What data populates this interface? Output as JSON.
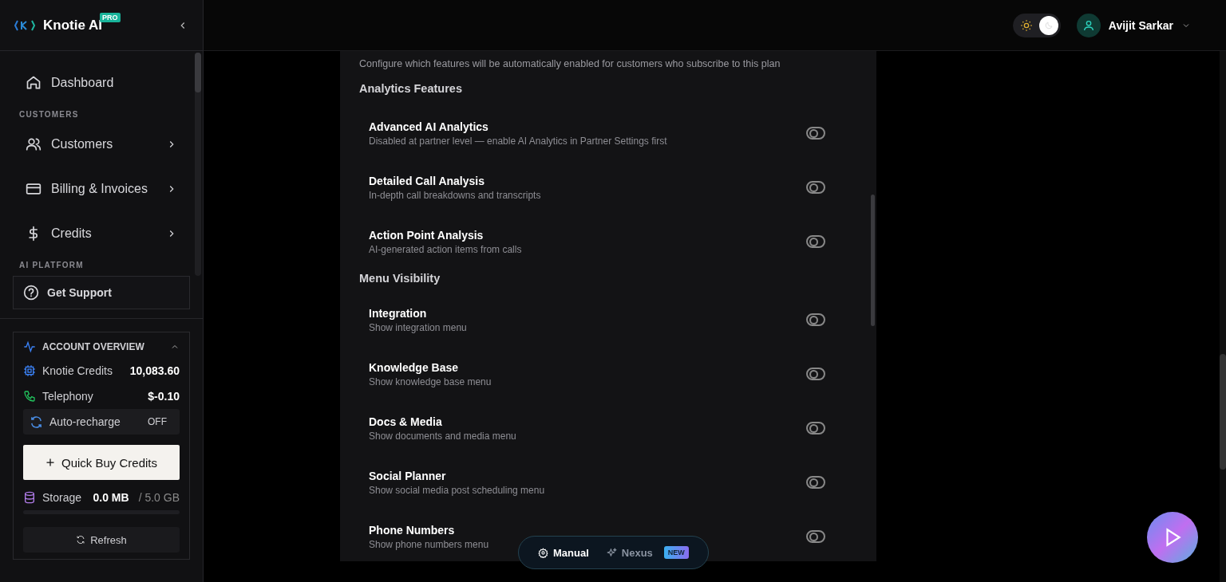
{
  "sidebar": {
    "brand": "Knotie AI",
    "badge": "PRO",
    "nav": [
      {
        "kind": "item",
        "label": "Dashboard",
        "chevron": false
      },
      {
        "kind": "section",
        "label": "CUSTOMERS"
      },
      {
        "kind": "item",
        "label": "Customers",
        "chevron": true
      },
      {
        "kind": "item",
        "label": "Billing & Invoices",
        "chevron": true
      },
      {
        "kind": "item",
        "label": "Credits",
        "chevron": true
      },
      {
        "kind": "section",
        "label": "AI PLATFORM"
      },
      {
        "kind": "boxed",
        "label": "Get Support"
      }
    ],
    "overview": {
      "title": "ACCOUNT OVERVIEW",
      "expanded": true,
      "credits": {
        "label": "Knotie Credits",
        "value": "10,083.60"
      },
      "telephony": {
        "label": "Telephony",
        "value": "$-0.10"
      },
      "auto_recharge": {
        "label": "Auto-recharge",
        "value": "OFF"
      },
      "buy": "Quick Buy Credits",
      "storage": {
        "label": "Storage",
        "used": "0.0 MB",
        "total": "/ 5.0 GB",
        "level": 0
      },
      "refresh": "Refresh"
    }
  },
  "header": {
    "theme_dark": true,
    "user": "Avijit Sarkar"
  },
  "panel": {
    "intro": "Configure which features will be automatically enabled for customers who subscribe to this plan",
    "groups": [
      {
        "title": "Analytics Features",
        "features": [
          {
            "name": "Advanced AI Analytics",
            "desc": "Disabled at partner level — enable AI Analytics in Partner Settings first",
            "on": false
          },
          {
            "name": "Detailed Call Analysis",
            "desc": "In-depth call breakdowns and transcripts",
            "on": false
          },
          {
            "name": "Action Point Analysis",
            "desc": "AI-generated action items from calls",
            "on": false
          }
        ]
      },
      {
        "title": "Menu Visibility",
        "features": [
          {
            "name": "Integration",
            "desc": "Show integration menu",
            "on": false
          },
          {
            "name": "Knowledge Base",
            "desc": "Show knowledge base menu",
            "on": false
          },
          {
            "name": "Docs & Media",
            "desc": "Show documents and media menu",
            "on": false
          },
          {
            "name": "Social Planner",
            "desc": "Show social media post scheduling menu",
            "on": false
          },
          {
            "name": "Phone Numbers",
            "desc": "Show phone numbers menu",
            "on": false
          }
        ]
      }
    ]
  },
  "mode_switch": [
    {
      "label": "Manual",
      "selected": true
    },
    {
      "label": "Nexus",
      "selected": false,
      "badge": "NEW"
    }
  ]
}
